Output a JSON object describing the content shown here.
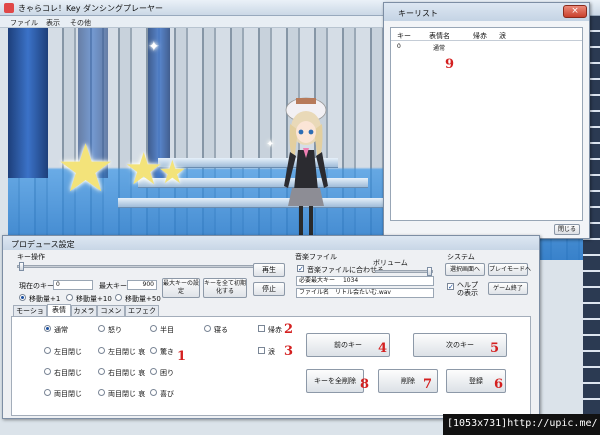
{
  "main": {
    "title": "きゃらコレ！Key ダンシングプレーヤー",
    "menu": [
      "ファイル",
      "表示",
      "その他"
    ]
  },
  "key_list": {
    "title": "キーリスト",
    "columns": [
      "キー",
      "表情名",
      "帰赤",
      "涙"
    ],
    "rows": [
      {
        "key": "0",
        "expression": "通常",
        "blush": "",
        "tears": ""
      }
    ],
    "close_label": "閉じる",
    "marker": "9"
  },
  "produce": {
    "title": "プロデュース設定",
    "key_op_label": "キー操作",
    "current_key_label": "現在のキー",
    "current_key_value": "0",
    "max_key_label": "最大キー",
    "max_key_value": "900",
    "max_key_setting_label": "最大キーの設定",
    "init_all_keys_label": "キーを全て初期化する",
    "play_label": "再生",
    "stop_label": "停止",
    "move_options": [
      "移動量+1",
      "移動量+10",
      "移動量+50"
    ],
    "music_file_label": "音楽ファイル",
    "sync_music_label": "音楽ファイルに合わせる",
    "required_max_key_label": "必要最大キー",
    "required_max_key_value": "1034",
    "filename_label": "ファイル名",
    "filename_value": "リトル会たいむ.wav",
    "volume_label": "ボリューム",
    "system_label": "システム",
    "select_screen_label": "選択画面へ",
    "play_mode_label": "プレイモードへ",
    "show_help_label": "ヘルプの表示",
    "game_end_label": "ゲーム終了",
    "tabs": [
      "モーション",
      "表情",
      "カメラ",
      "コメント",
      "エフェクト"
    ],
    "active_tab": "表情",
    "expressions": [
      [
        "通常",
        "左目閉じ",
        "右目閉じ",
        "両目閉じ"
      ],
      [
        "怒り",
        "左目閉じ 哀",
        "右目閉じ 哀",
        "両目閉じ 哀"
      ],
      [
        "半目",
        "驚き",
        "困り",
        "喜び"
      ],
      [
        "寝る"
      ]
    ],
    "blush_label": "帰赤",
    "tears_label": "涙",
    "prev_key_label": "前のキー",
    "next_key_label": "次のキー",
    "delete_all_keys_label": "キーを全削除",
    "delete_label": "削除",
    "register_label": "登録",
    "markers": {
      "expressions": "1",
      "blush": "2",
      "tears": "3",
      "prev": "4",
      "next": "5",
      "register": "6",
      "delete": "7",
      "delete_all": "8"
    }
  },
  "footer": {
    "text": "[1053x731]http://upic.me/"
  },
  "colors": {
    "marker": "#d42020",
    "titlebar": "#cbd8e6",
    "stage_blue": "#3b72c8",
    "star": "#f3e37a"
  }
}
